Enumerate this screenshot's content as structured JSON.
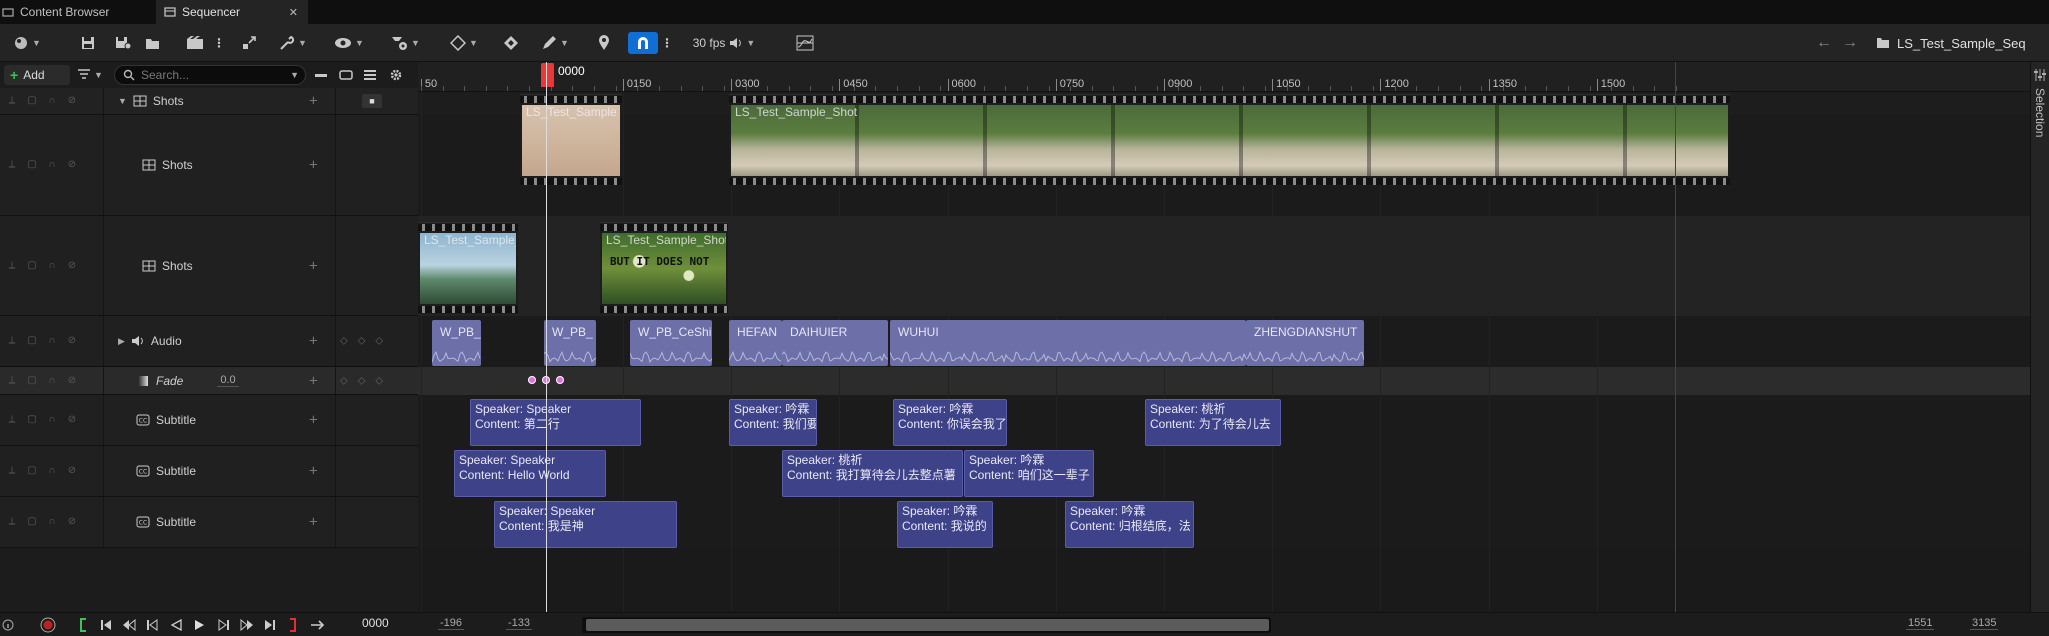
{
  "tabs": [
    {
      "label": "Content Browser"
    },
    {
      "label": "Sequencer",
      "close": "✕"
    }
  ],
  "toolbar": {
    "fps": "30 fps",
    "sequence_name": "LS_Test_Sample_Seq",
    "back_icon": "arrow-left-icon",
    "forward_icon": "arrow-right-icon",
    "snap_enabled": true,
    "accent": "#0f6fd6"
  },
  "outliner": {
    "add_label": "Add",
    "search_placeholder": "Search...",
    "rows": [
      {
        "label": "Shots",
        "kind": "shots-folder"
      },
      {
        "label": "Shots",
        "kind": "shots-track"
      },
      {
        "label": "Shots",
        "kind": "shots-track"
      },
      {
        "label": "Audio",
        "kind": "audio"
      },
      {
        "label": "Fade",
        "kind": "fade",
        "value": "0.0"
      },
      {
        "label": "Subtitle",
        "kind": "subtitle"
      },
      {
        "label": "Subtitle",
        "kind": "subtitle"
      },
      {
        "label": "Subtitle",
        "kind": "subtitle"
      }
    ]
  },
  "ruler": {
    "labels": [
      "50",
      "0150",
      "0300",
      "0450",
      "0600",
      "0750",
      "0900",
      "1050",
      "1200",
      "1350",
      "1500"
    ],
    "playhead_label": "0000"
  },
  "shot_clips": {
    "row1": [
      {
        "label": "LS_Test_Sample"
      },
      {
        "label": "LS_Test_Sample_Shot"
      }
    ],
    "row2": [
      {
        "label": "LS_Test_Sample_Sh"
      },
      {
        "label": "LS_Test_Sample_Shot",
        "overlay": "BUT IT DOES NOT"
      }
    ]
  },
  "audio_clips": [
    {
      "label": "W_PB_"
    },
    {
      "label": "W_PB_"
    },
    {
      "label": "W_PB_CeShi"
    },
    {
      "label": "HEFAN"
    },
    {
      "label": "DAIHUIER"
    },
    {
      "label": "WUHUI"
    },
    {
      "label": "ZHENGDIANSHUT"
    }
  ],
  "subtitles": {
    "row1": [
      {
        "speaker": "Speaker: Speaker",
        "content": "Content: 第二行"
      },
      {
        "speaker": "Speaker: 吟霖",
        "content": "Content: 我们要"
      },
      {
        "speaker": "Speaker: 吟霖",
        "content": "Content: 你误会我了"
      },
      {
        "speaker": "Speaker: 桃祈",
        "content": "Content: 为了待会儿去"
      }
    ],
    "row2": [
      {
        "speaker": "Speaker: Speaker",
        "content": "Content: Hello World"
      },
      {
        "speaker": "Speaker: 桃祈",
        "content": "Content: 我打算待会儿去整点薯"
      },
      {
        "speaker": "Speaker: 吟霖",
        "content": "Content: 咱们这一辈子"
      }
    ],
    "row3": [
      {
        "speaker": "Speaker: Speaker",
        "content": "Content: 我是神"
      },
      {
        "speaker": "Speaker: 吟霖",
        "content": "Content: 我说的"
      },
      {
        "speaker": "Speaker: 吟霖",
        "content": "Content: 归根结底，法"
      }
    ]
  },
  "right_rail": {
    "label": "Selection"
  },
  "transport": {
    "current_time": "0000",
    "view_start": "-196",
    "work_start": "-133",
    "work_end": "1551",
    "view_end": "3135"
  }
}
